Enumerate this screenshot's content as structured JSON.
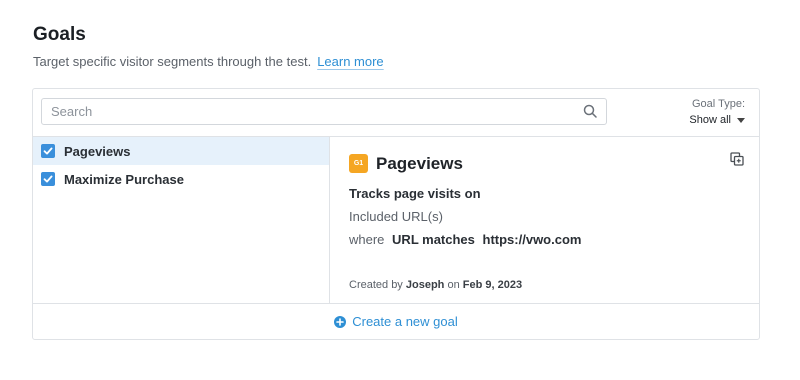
{
  "header": {
    "title": "Goals",
    "subtitle": "Target specific visitor segments through the test.",
    "learn_more": "Learn more"
  },
  "search": {
    "placeholder": "Search",
    "value": ""
  },
  "goal_type": {
    "label": "Goal Type:",
    "value": "Show all"
  },
  "goals": [
    {
      "label": "Pageviews",
      "checked": true,
      "selected": true
    },
    {
      "label": "Maximize Purchase",
      "checked": true,
      "selected": false
    }
  ],
  "detail": {
    "badge": "G1",
    "title": "Pageviews",
    "tracks": "Tracks page visits on",
    "included": "Included URL(s)",
    "where": "where",
    "match_type": "URL matches",
    "url": "https://vwo.com",
    "created_prefix": "Created by",
    "created_by": "Joseph",
    "created_on_prefix": "on",
    "created_date": "Feb 9, 2023"
  },
  "footer": {
    "create_label": "Create a new goal"
  },
  "colors": {
    "accent": "#2e8fd4",
    "checkbox": "#3a8fdb",
    "badge": "#f5a623",
    "selected_row": "#e6f1fb"
  },
  "icons": {
    "search": "search-icon",
    "checkbox": "checkbox-checked-icon",
    "copy": "copy-icon",
    "caret": "caret-down-icon",
    "add": "plus-circle-icon"
  }
}
